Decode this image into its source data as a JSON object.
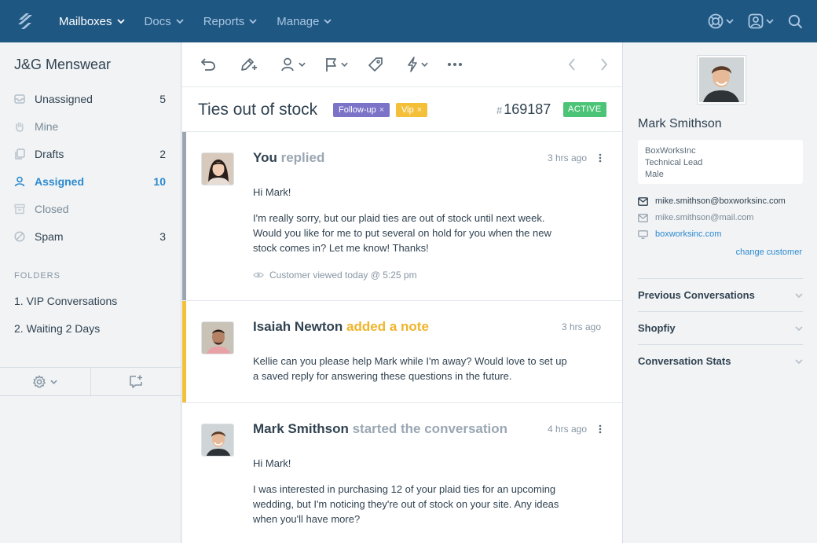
{
  "nav": {
    "items": [
      {
        "label": "Mailboxes",
        "active": true
      },
      {
        "label": "Docs"
      },
      {
        "label": "Reports"
      },
      {
        "label": "Manage"
      }
    ]
  },
  "sidebar": {
    "mailbox_title": "J&G Menswear",
    "folders": [
      {
        "label": "Unassigned",
        "count": "5",
        "icon": "inbox-icon"
      },
      {
        "label": "Mine",
        "count": "",
        "icon": "hand-icon"
      },
      {
        "label": "Drafts",
        "count": "2",
        "icon": "drafts-icon"
      },
      {
        "label": "Assigned",
        "count": "10",
        "icon": "person-icon"
      },
      {
        "label": "Closed",
        "count": "",
        "icon": "archive-icon"
      },
      {
        "label": "Spam",
        "count": "3",
        "icon": "spam-icon"
      }
    ],
    "folders_heading": "FOLDERS",
    "custom_folders": [
      "1. VIP Conversations",
      "2. Waiting 2 Days"
    ]
  },
  "conversation": {
    "subject": "Ties out of stock",
    "tags": [
      "Follow-up",
      "Vip"
    ],
    "tag_close": "×",
    "hash": "#",
    "number": "169187",
    "status": "ACTIVE",
    "threads": [
      {
        "who": "You",
        "action": "replied",
        "time": "3 hrs ago",
        "body": [
          "Hi Mark!",
          "I'm really sorry, but our plaid ties are out of stock until next week. Would you like for me to put several on hold for you when the new stock comes in? Let me know! Thanks!"
        ],
        "viewed": "Customer viewed today @ 5:25 pm"
      },
      {
        "who": "Isaiah Newton",
        "action": "added a note",
        "time": "3 hrs ago",
        "body": [
          "Kellie can you please help Mark while I'm away? Would love to set up a saved reply for answering these questions in the future."
        ]
      },
      {
        "who": "Mark Smithson",
        "action": "started the conversation",
        "time": "4 hrs ago",
        "body": [
          "Hi Mark!",
          "I was interested in purchasing 12 of your plaid ties for an upcoming wedding, but I'm noticing they're out of stock on your site. Any ideas when you'll have more?"
        ]
      }
    ]
  },
  "customer": {
    "name": "Mark Smithson",
    "company": "BoxWorksInc",
    "title": "Technical Lead",
    "gender": "Male",
    "email_primary": "mike.smithson@boxworksinc.com",
    "email_secondary": "mike.smithson@mail.com",
    "website": "boxworksinc.com",
    "change_link": "change customer",
    "sections": [
      "Previous Conversations",
      "Shopfiy",
      "Conversation Stats"
    ]
  },
  "colors": {
    "nav_bg": "#1f5783",
    "accent": "#2b8acf",
    "follow_up_tag": "#7a73c8",
    "vip_tag": "#f4c03a",
    "active_status": "#4cc477",
    "reply_bar": "#9aa7b2",
    "note_bar": "#f4c03a"
  }
}
